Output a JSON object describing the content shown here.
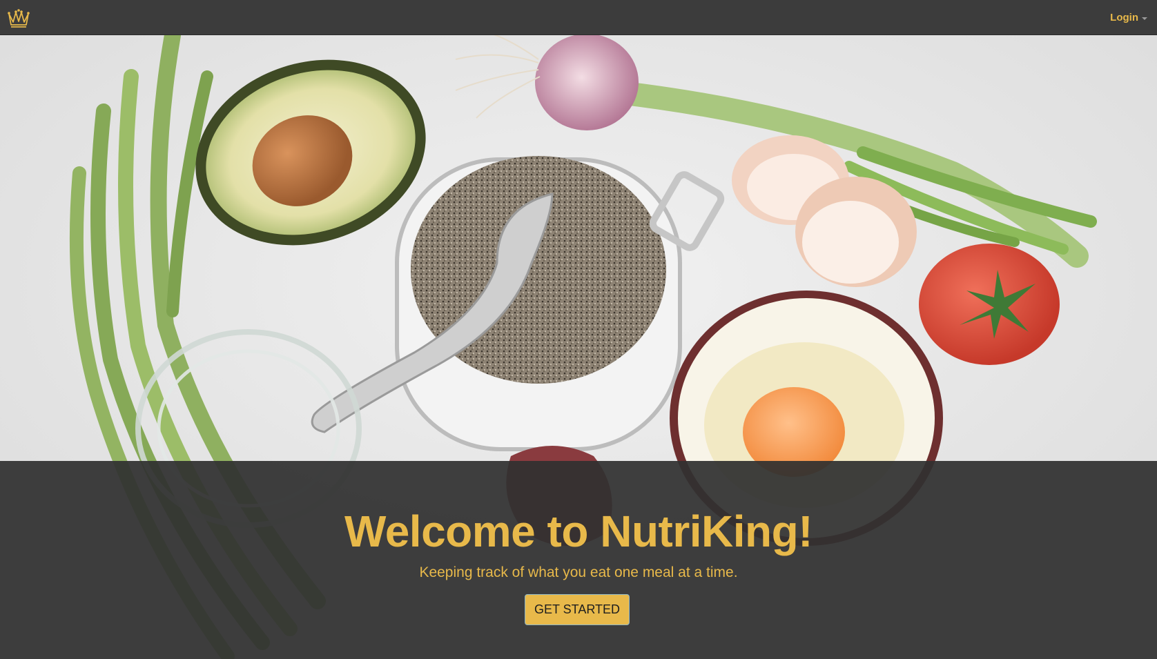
{
  "navbar": {
    "brand_icon": "crown-icon",
    "login_label": "Login",
    "login_caret_icon": "caret-down-icon"
  },
  "hero": {
    "background_image": "food-ingredients-photo",
    "headline": "Welcome to NutriKing!",
    "tagline": "Keeping track of what you eat one meal at a time.",
    "cta_label": "GET STARTED"
  },
  "colors": {
    "accent": "#e8b94a",
    "navbar_bg": "#3c3c3c",
    "overlay_bg": "#303030"
  }
}
